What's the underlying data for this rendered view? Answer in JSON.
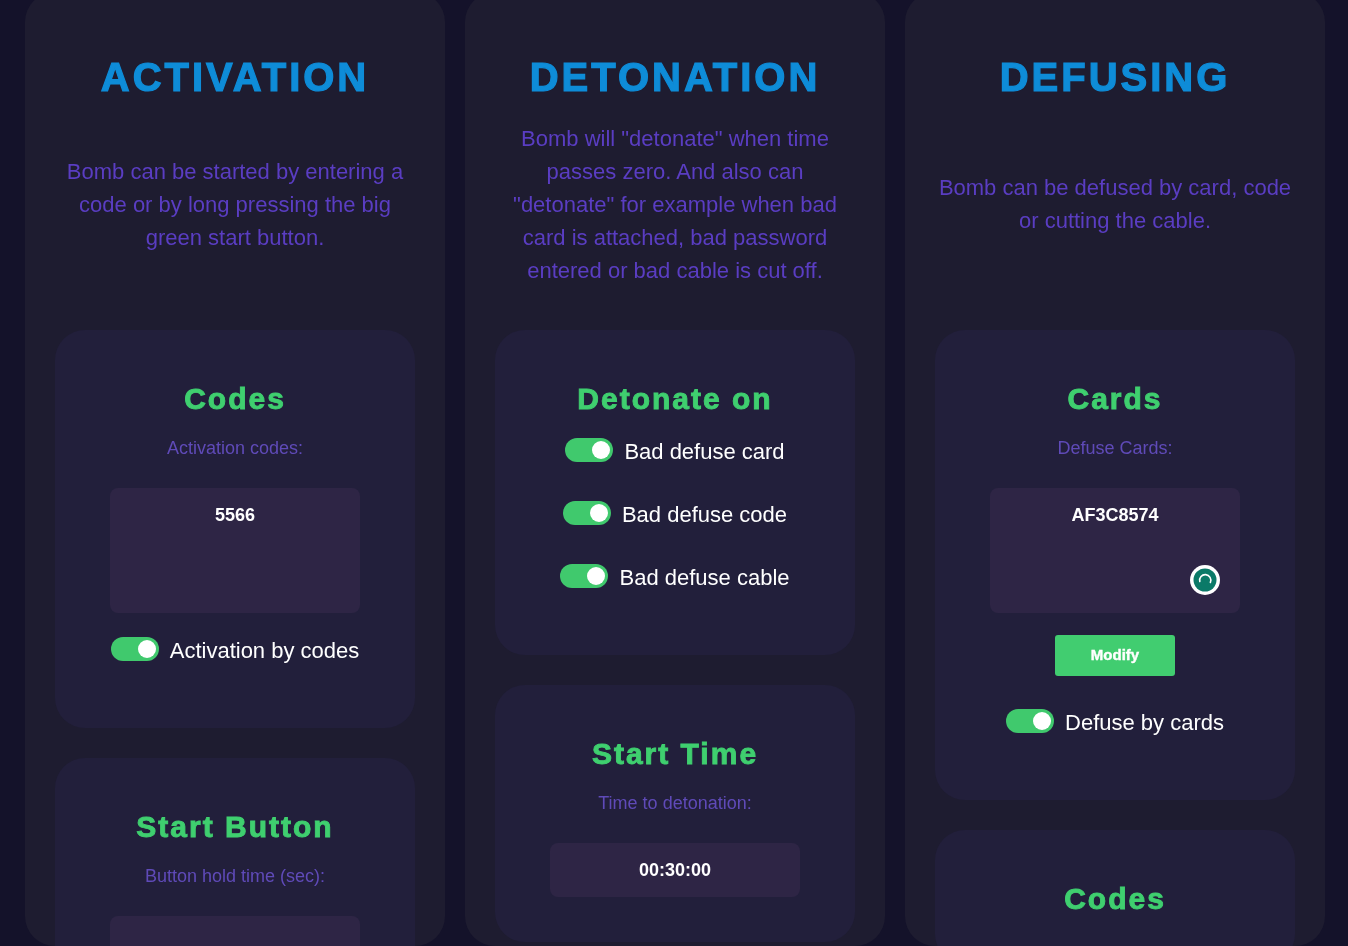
{
  "columns": [
    {
      "title": "ACTIVATION",
      "description": "Bomb can be started by entering a code or by long pressing the big green start button.",
      "cards": [
        {
          "title": "Codes",
          "label": "Activation codes:",
          "field": {
            "kind": "textarea",
            "value": "5566",
            "extension_icon": false
          },
          "toggles": [
            {
              "label": "Activation by codes",
              "on": true
            }
          ]
        },
        {
          "title": "Start Button",
          "label": "Button hold time (sec):",
          "field": {
            "kind": "input"
          }
        }
      ]
    },
    {
      "title": "DETONATION",
      "description": "Bomb will \"detonate\" when time passes zero. And also can \"detonate\" for example when bad card is attached, bad password entered or bad cable is cut off.",
      "cards": [
        {
          "title": "Detonate on",
          "toggles": [
            {
              "label": "Bad defuse card",
              "on": true
            },
            {
              "label": "Bad defuse code",
              "on": true
            },
            {
              "label": "Bad defuse cable",
              "on": true
            }
          ]
        },
        {
          "title": "Start Time",
          "label": "Time to detonation:",
          "field": {
            "kind": "input",
            "value": "00:30:00"
          }
        }
      ]
    },
    {
      "title": "DEFUSING",
      "description": "Bomb can be defused by card, code or cutting the cable.",
      "cards": [
        {
          "title": "Cards",
          "label": "Defuse Cards:",
          "field": {
            "kind": "textarea",
            "value": "AF3C8574",
            "extension_icon": true
          },
          "button": "Modify",
          "toggles": [
            {
              "label": "Defuse by cards",
              "on": true
            }
          ]
        },
        {
          "title": "Codes"
        }
      ]
    }
  ]
}
